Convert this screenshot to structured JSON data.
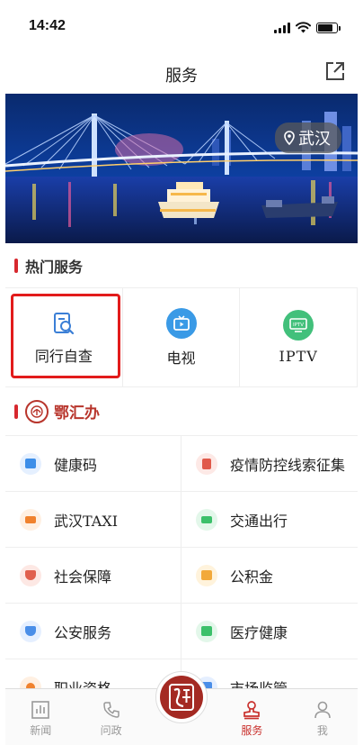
{
  "status_bar": {
    "time": "14:42"
  },
  "nav": {
    "title": "服务"
  },
  "banner": {
    "location": "武汉"
  },
  "hot_section": {
    "title": "热门服务",
    "items": [
      {
        "label": "同行自查",
        "icon": "search-doc-icon"
      },
      {
        "label": "电视",
        "icon": "tv-icon"
      },
      {
        "label": "IPTV",
        "icon": "iptv-icon"
      }
    ]
  },
  "ehui_section": {
    "title": "鄂汇办"
  },
  "services": [
    {
      "label": "健康码",
      "icon": "medical-kit-icon",
      "color": "#3d8ee8"
    },
    {
      "label": "疫情防控线索征集",
      "icon": "clipboard-icon",
      "color": "#e05a4b"
    },
    {
      "label": "武汉TAXI",
      "icon": "taxi-icon",
      "color": "#f0822e"
    },
    {
      "label": "交通出行",
      "icon": "car-icon",
      "color": "#3cc06a"
    },
    {
      "label": "社会保障",
      "icon": "shield-icon",
      "color": "#e0604e"
    },
    {
      "label": "公积金",
      "icon": "house-icon",
      "color": "#f2a93b"
    },
    {
      "label": "公安服务",
      "icon": "police-badge-icon",
      "color": "#4a8ee8"
    },
    {
      "label": "医疗健康",
      "icon": "medical-bag-icon",
      "color": "#3cc06a"
    },
    {
      "label": "职业资格",
      "icon": "person-icon",
      "color": "#f0822e"
    },
    {
      "label": "市场监管",
      "icon": "megaphone-icon",
      "color": "#4a8ee8"
    }
  ],
  "tabbar": {
    "items": [
      {
        "label": "新闻",
        "icon": "news-chart-icon",
        "active": false
      },
      {
        "label": "问政",
        "icon": "phone-icon",
        "active": false
      },
      {
        "label": "",
        "icon": "center-seal-icon",
        "active": false
      },
      {
        "label": "服务",
        "icon": "service-stamp-icon",
        "active": true
      },
      {
        "label": "我",
        "icon": "user-icon",
        "active": false
      }
    ]
  },
  "colors": {
    "accent": "#d7282f",
    "active_tab": "#c9302c",
    "highlight_border": "#e21b1b"
  }
}
